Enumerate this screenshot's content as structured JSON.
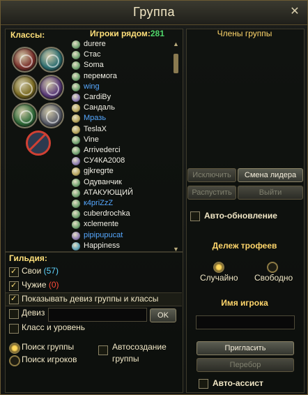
{
  "window": {
    "title": "Группа",
    "close_icon": "close-icon"
  },
  "left": {
    "classes_label": "Классы:",
    "players_nearby_label": "Игроки рядом:",
    "players_nearby_count": "281",
    "players": [
      {
        "name": "durere",
        "color": "#f2f0e6",
        "icon_color": "#6ea06e"
      },
      {
        "name": "Стас",
        "color": "#f2f0e6",
        "icon_color": "#6ea06e"
      },
      {
        "name": "Soma",
        "color": "#f2f0e6",
        "icon_color": "#6ea06e"
      },
      {
        "name": "перемога",
        "color": "#f2f0e6",
        "icon_color": "#6ea06e"
      },
      {
        "name": "wing",
        "color": "#56a8ff",
        "icon_color": "#6ea06e"
      },
      {
        "name": "CardiBy",
        "color": "#f2f0e6",
        "icon_color": "#8a7ab0"
      },
      {
        "name": "Сандаль",
        "color": "#f2f0e6",
        "icon_color": "#b5a35a"
      },
      {
        "name": "Мразь",
        "color": "#56a8ff",
        "icon_color": "#b5a35a"
      },
      {
        "name": "TeslaX",
        "color": "#f2f0e6",
        "icon_color": "#b5a35a"
      },
      {
        "name": "Vine",
        "color": "#f2f0e6",
        "icon_color": "#6ea06e"
      },
      {
        "name": "Arrivederci",
        "color": "#f2f0e6",
        "icon_color": "#6ea06e"
      },
      {
        "name": "CУ4КА2008",
        "color": "#f2f0e6",
        "icon_color": "#8a7ab0"
      },
      {
        "name": "gjkregrte",
        "color": "#f2f0e6",
        "icon_color": "#b5a35a"
      },
      {
        "name": "Одуванчик",
        "color": "#f2f0e6",
        "icon_color": "#6ea06e"
      },
      {
        "name": "АТАКУЮЩИЙ",
        "color": "#f2f0e6",
        "icon_color": "#6ea06e"
      },
      {
        "name": "к4priZzZ",
        "color": "#56a8ff",
        "icon_color": "#6ea06e"
      },
      {
        "name": "cuberdrochka",
        "color": "#f2f0e6",
        "icon_color": "#6ea06e"
      },
      {
        "name": "xclemente",
        "color": "#f2f0e6",
        "icon_color": "#6ea06e"
      },
      {
        "name": "pipipupucat",
        "color": "#56a8ff",
        "icon_color": "#8a7ab0"
      },
      {
        "name": "Happiness",
        "color": "#f2f0e6",
        "icon_color": "#5aa0b5"
      }
    ],
    "classes": [
      {
        "name": "class-warrior-icon",
        "color": "#7a2f2a"
      },
      {
        "name": "class-mage-icon",
        "color": "#2d6f72"
      },
      {
        "name": "class-priest-icon",
        "color": "#7a6a20"
      },
      {
        "name": "class-warlock-icon",
        "color": "#5a3a7a"
      },
      {
        "name": "class-ranger-icon",
        "color": "#2e6a38"
      },
      {
        "name": "class-rogue-icon",
        "color": "#5a5d6a"
      }
    ]
  },
  "guild": {
    "label": "Гильдия:",
    "own_label": "Свои",
    "own_count": "(57)",
    "foreign_label": "Чужие",
    "foreign_count": "(0)",
    "show_motto_label": "Показывать девиз группы и классы",
    "motto_label": "Девиз",
    "ok_label": "OK",
    "class_level_label": "Класс и уровень",
    "search_group_label": "Поиск группы",
    "search_players_label": "Поиск игроков",
    "autocreate_label_1": "Автосоздание",
    "autocreate_label_2": "группы"
  },
  "right": {
    "members_label": "Члены группы",
    "exclude_label": "Исключить",
    "change_leader_label": "Смена лидера",
    "disband_label": "Распустить",
    "exit_label": "Выйти",
    "auto_update_label": "Авто-обновление",
    "loot_label": "Дележ трофеев",
    "random_label": "Случайно",
    "free_label": "Свободно",
    "player_name_label": "Имя игрока",
    "invite_label": "Пригласить",
    "pick_label": "Перебор",
    "auto_assist_label": "Авто-ассист"
  },
  "colors": {
    "accent_gold": "#ffe07a",
    "count_green": "#4fd66a",
    "count_cyan": "#5fd4ff",
    "count_red": "#ff4a3a"
  }
}
